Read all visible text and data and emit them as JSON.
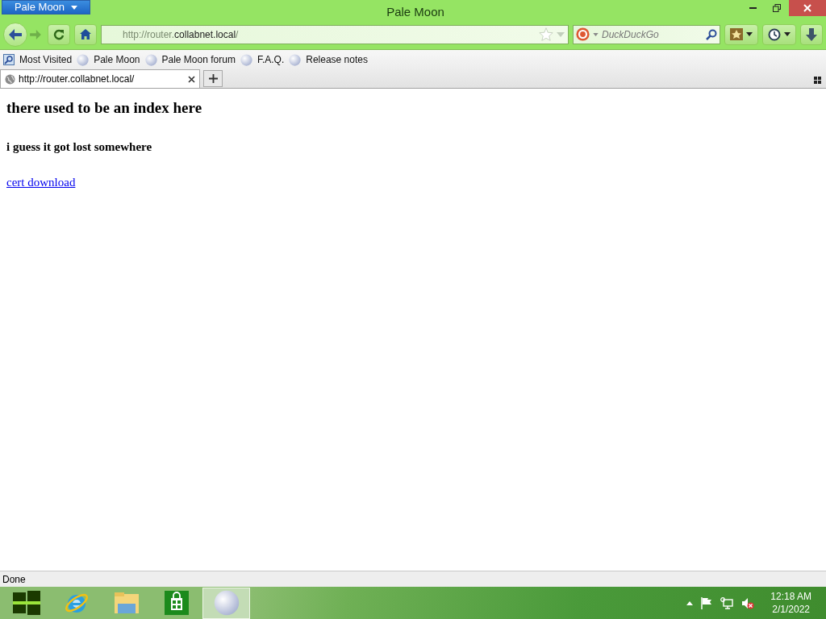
{
  "window": {
    "app_button": "Pale Moon",
    "title": "Pale Moon"
  },
  "nav": {
    "url_prefix": "http://router.",
    "url_host": "collabnet.local",
    "url_suffix": "/",
    "search_placeholder": "DuckDuckGo"
  },
  "bookmarks": [
    {
      "label": "Most Visited",
      "kind": "folder"
    },
    {
      "label": "Pale Moon",
      "kind": "page"
    },
    {
      "label": "Pale Moon forum",
      "kind": "page"
    },
    {
      "label": "F.A.Q.",
      "kind": "page"
    },
    {
      "label": "Release notes",
      "kind": "page"
    }
  ],
  "tabs": [
    {
      "label": "http://router.collabnet.local/",
      "selected": true
    }
  ],
  "page": {
    "heading": "there used to be an index here",
    "subheading": "i guess it got lost somewhere",
    "link": "cert download"
  },
  "status_bar": {
    "text": "Done"
  },
  "taskbar": {
    "apps": [
      {
        "kind": "windows",
        "selected": false
      },
      {
        "kind": "ie",
        "selected": false
      },
      {
        "kind": "explorer",
        "selected": false
      },
      {
        "kind": "store",
        "selected": false
      },
      {
        "kind": "moon",
        "selected": true
      }
    ],
    "time": "12:18 AM",
    "date": "2/1/2022"
  }
}
